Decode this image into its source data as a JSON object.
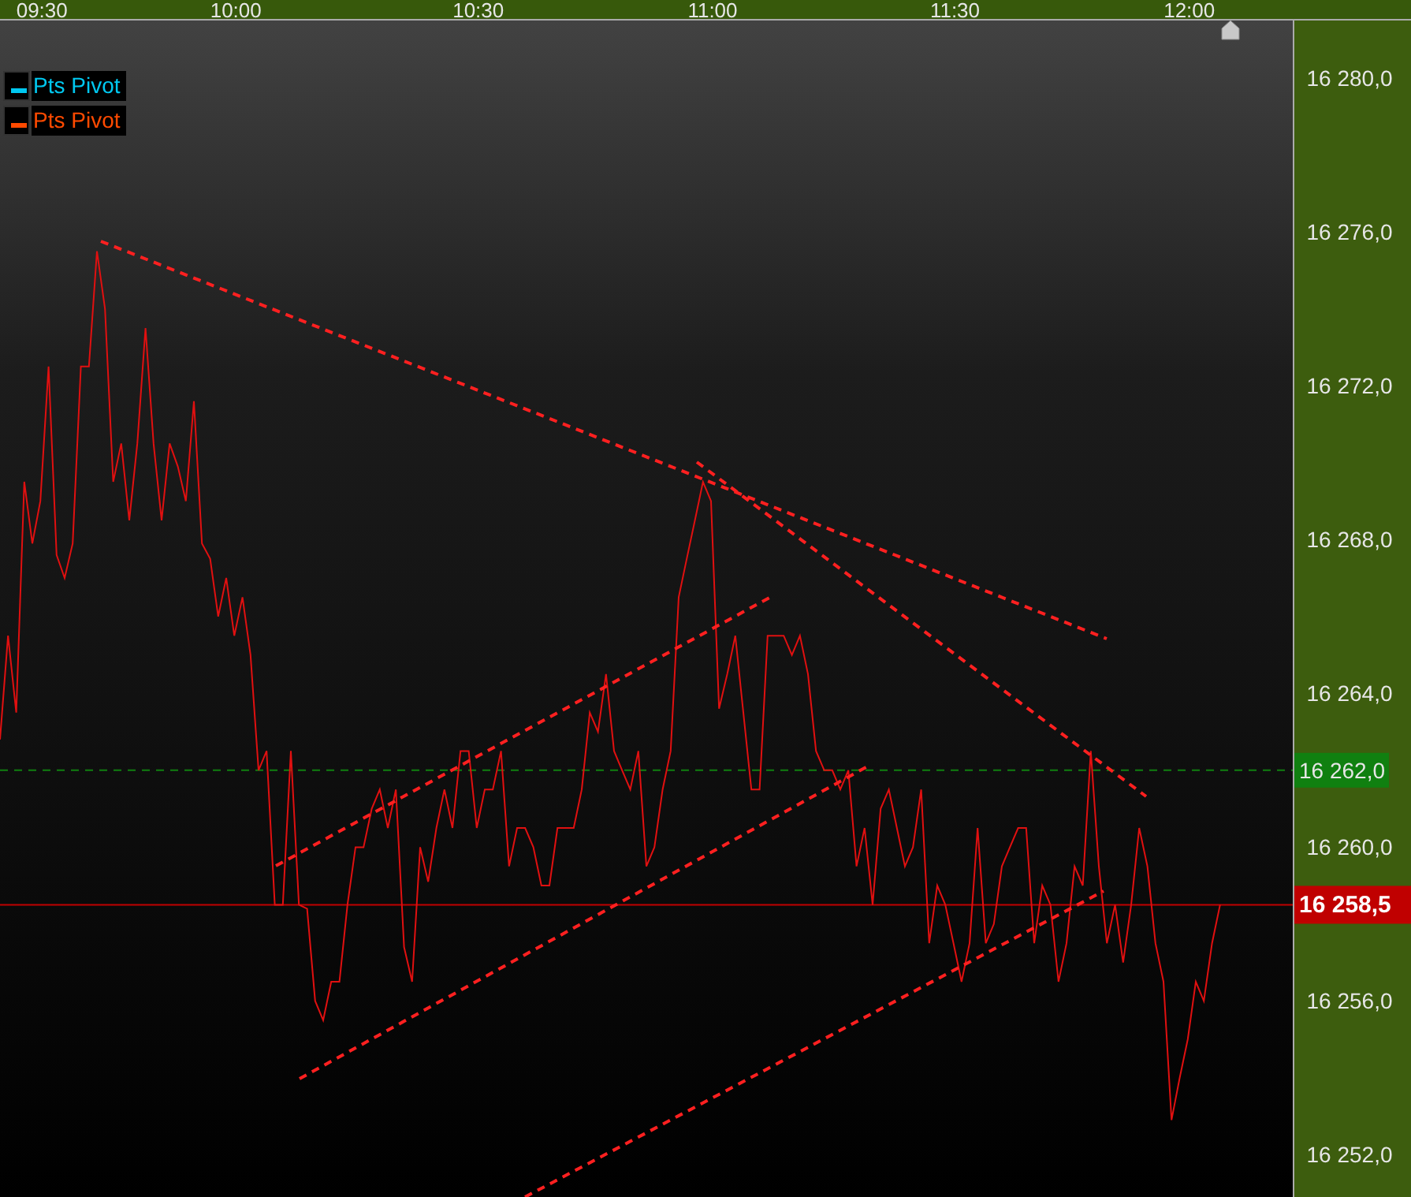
{
  "legend": [
    {
      "label": "Pts Pivot",
      "color": "#00c8f0"
    },
    {
      "label": "Pts Pivot",
      "color": "#ff4a00"
    }
  ],
  "chart_data": {
    "type": "line",
    "ylim": [
      16250.9,
      16281.5
    ],
    "categories": [
      null,
      null,
      null,
      null,
      null,
      "09:30",
      null,
      null,
      null,
      null,
      null,
      null,
      null,
      null,
      null,
      null,
      null,
      null,
      null,
      null,
      null,
      null,
      null,
      null,
      null,
      null,
      null,
      null,
      null,
      "10:00",
      null,
      null,
      null,
      null,
      null,
      null,
      null,
      null,
      null,
      null,
      null,
      null,
      null,
      null,
      null,
      null,
      null,
      null,
      null,
      null,
      null,
      null,
      null,
      null,
      null,
      null,
      null,
      null,
      null,
      "10:30",
      null,
      null,
      null,
      null,
      null,
      null,
      null,
      null,
      null,
      null,
      null,
      null,
      null,
      null,
      null,
      null,
      null,
      null,
      null,
      null,
      null,
      null,
      null,
      null,
      null,
      null,
      null,
      null,
      "11:00",
      null,
      null,
      null,
      null,
      null,
      null,
      null,
      null,
      null,
      null,
      null,
      null,
      null,
      null,
      null,
      null,
      null,
      null,
      null,
      null,
      null,
      null,
      null,
      null,
      null,
      null,
      null,
      null,
      null,
      "11:30",
      null,
      null,
      null,
      null,
      null,
      null,
      null,
      null,
      null,
      null,
      null,
      null,
      null,
      null,
      null,
      null,
      null,
      null,
      null,
      null,
      null,
      null,
      null,
      null,
      null,
      null,
      null,
      null,
      "12:00",
      null,
      null,
      null,
      null
    ],
    "yticks": [
      {
        "value": 16280,
        "label": "16 280,0"
      },
      {
        "value": 16276,
        "label": "16 276,0"
      },
      {
        "value": 16272,
        "label": "16 272,0"
      },
      {
        "value": 16268,
        "label": "16 268,0"
      },
      {
        "value": 16264,
        "label": "16 264,0"
      },
      {
        "value": 16260,
        "label": "16 260,0"
      },
      {
        "value": 16256,
        "label": "16 256,0"
      },
      {
        "value": 16252,
        "label": "16 252,0"
      }
    ],
    "series": [
      {
        "color": "#e01010",
        "values": [
          16262.8,
          16265.5,
          16263.5,
          16269.5,
          16267.9,
          16269.0,
          16272.5,
          16267.6,
          16267.0,
          16267.9,
          16272.5,
          16272.5,
          16275.5,
          16274.0,
          16269.5,
          16270.5,
          16268.5,
          16270.5,
          16273.5,
          16270.5,
          16268.5,
          16270.5,
          16269.9,
          16269.0,
          16271.6,
          16267.9,
          16267.5,
          16266.0,
          16267.0,
          16265.5,
          16266.5,
          16265.0,
          16262.0,
          16262.5,
          16258.5,
          16258.5,
          16262.5,
          16258.5,
          16258.4,
          16256.0,
          16255.5,
          16256.5,
          16256.5,
          16258.5,
          16260.0,
          16260.0,
          16261.0,
          16261.5,
          16260.5,
          16261.5,
          16257.4,
          16256.5,
          16260.0,
          16259.1,
          16260.5,
          16261.5,
          16260.5,
          16262.5,
          16262.5,
          16260.5,
          16261.5,
          16261.5,
          16262.5,
          16259.5,
          16260.5,
          16260.5,
          16260.0,
          16259.0,
          16259.0,
          16260.5,
          16260.5,
          16260.5,
          16261.5,
          16263.5,
          16263.0,
          16264.5,
          16262.5,
          16262.0,
          16261.5,
          16262.5,
          16259.5,
          16260.0,
          16261.5,
          16262.5,
          16266.5,
          16267.5,
          16268.5,
          16269.5,
          16269.0,
          16263.6,
          16264.5,
          16265.5,
          16263.5,
          16261.5,
          16261.5,
          16265.5,
          16265.5,
          16265.5,
          16265.0,
          16265.5,
          16264.5,
          16262.5,
          16262.0,
          16262.0,
          16261.5,
          16262.0,
          16259.5,
          16260.5,
          16258.5,
          16261.0,
          16261.5,
          16260.5,
          16259.5,
          16260.0,
          16261.5,
          16257.5,
          16259.0,
          16258.5,
          16257.5,
          16256.5,
          16257.5,
          16260.5,
          16257.5,
          16258.0,
          16259.5,
          16260.0,
          16260.5,
          16260.5,
          16257.5,
          16259.0,
          16258.5,
          16256.5,
          16257.5,
          16259.5,
          16259.0,
          16262.5,
          16259.5,
          16257.5,
          16258.5,
          16257.0,
          16258.5,
          16260.5,
          16259.5,
          16257.5,
          16256.5,
          16252.9,
          16254.0,
          16255.0,
          16256.5,
          16256.0,
          16257.5,
          16258.5
        ]
      }
    ],
    "ref_lines": [
      {
        "axis": "y",
        "value": 16262.0,
        "label": "16 262,0",
        "color": "#108010"
      },
      {
        "axis": "y",
        "value": 16258.5,
        "label": "16 258,5",
        "color": "#c00000"
      }
    ]
  }
}
